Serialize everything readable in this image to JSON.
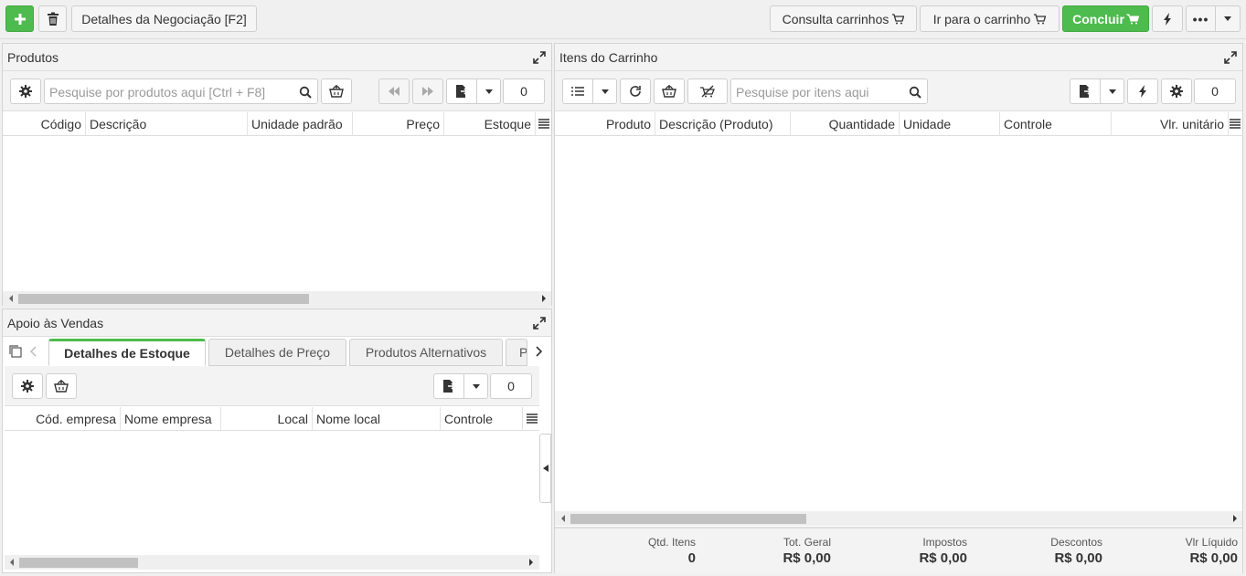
{
  "top_toolbar": {
    "details_button": "Detalhes da Negociação [F2]",
    "consult_carts": "Consulta carrinhos",
    "go_to_cart": "Ir para o carrinho",
    "conclude": "Concluir"
  },
  "produtos": {
    "title": "Produtos",
    "search_placeholder": "Pesquise por produtos aqui [Ctrl + F8]",
    "count": "0",
    "columns": [
      "Código",
      "Descrição",
      "Unidade padrão",
      "Preço",
      "Estoque"
    ]
  },
  "apoio": {
    "title": "Apoio às Vendas",
    "tabs": [
      "Detalhes de Estoque",
      "Detalhes de Preço",
      "Produtos Alternativos",
      "P"
    ],
    "count": "0",
    "columns": [
      "Cód. empresa",
      "Nome empresa",
      "Local",
      "Nome local",
      "Controle"
    ]
  },
  "itens": {
    "title": "Itens do Carrinho",
    "search_placeholder": "Pesquise por itens aqui",
    "count": "0",
    "columns": [
      "Produto",
      "Descrição (Produto)",
      "Quantidade",
      "Unidade",
      "Controle",
      "Vlr. unitário"
    ]
  },
  "summary": {
    "qtd_label": "Qtd. Itens",
    "qtd_value": "0",
    "total_label": "Tot. Geral",
    "total_value": "R$ 0,00",
    "impostos_label": "Impostos",
    "impostos_value": "R$ 0,00",
    "descontos_label": "Descontos",
    "descontos_value": "R$ 0,00",
    "liquido_label": "Vlr Líquido",
    "liquido_value": "R$ 0,00"
  },
  "colors": {
    "accent_green": "#4dbb4d",
    "panel_header": "#f3f3f3",
    "border": "#d4d4d4"
  }
}
